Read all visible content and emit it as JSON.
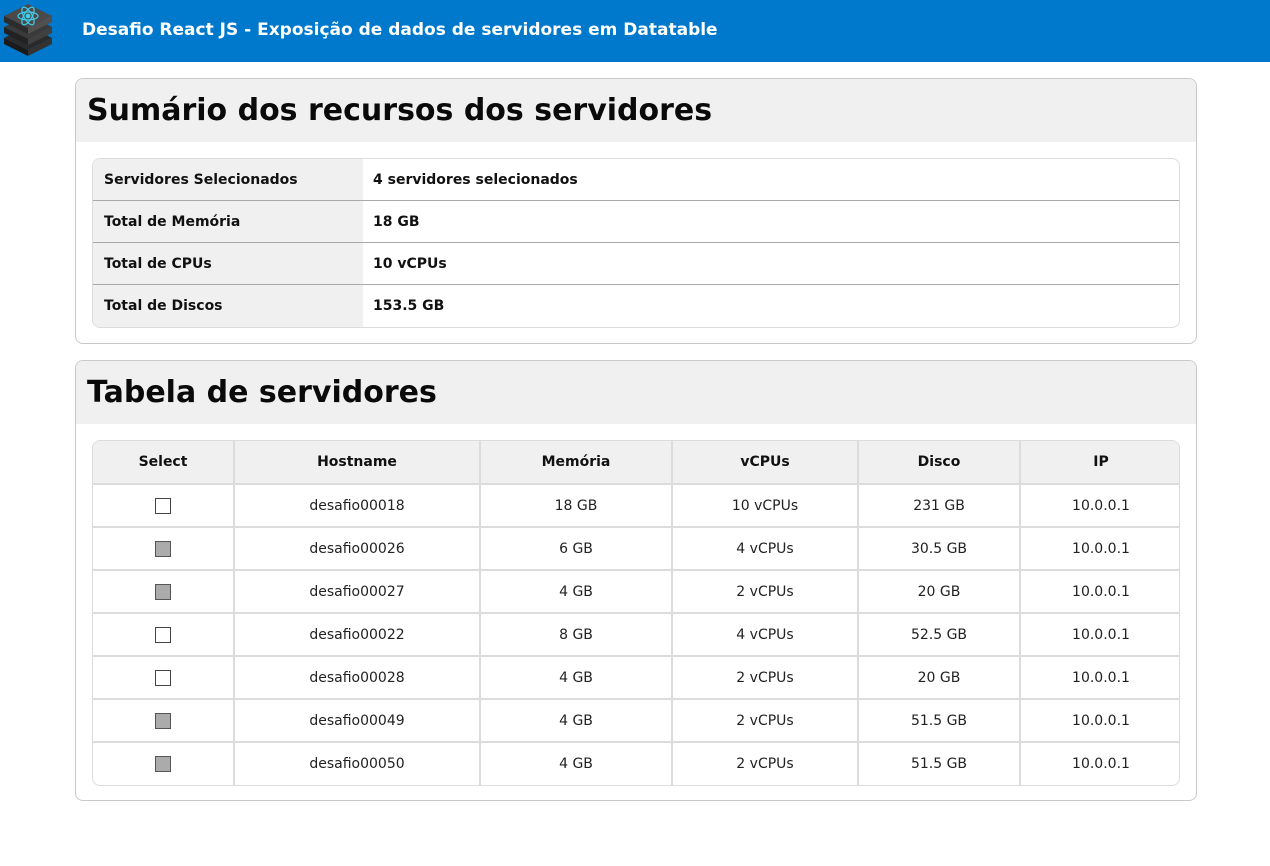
{
  "header": {
    "title": "Desafio React JS - Exposição de dados de servidores em Datatable",
    "logo_icon": "react-server-stack-icon"
  },
  "summary": {
    "title": "Sumário dos recursos dos servidores",
    "rows": [
      {
        "label": "Servidores Selecionados",
        "value": "4 servidores selecionados"
      },
      {
        "label": "Total de Memória",
        "value": "18 GB"
      },
      {
        "label": "Total de CPUs",
        "value": "10 vCPUs"
      },
      {
        "label": "Total de Discos",
        "value": "153.5 GB"
      }
    ]
  },
  "servers": {
    "title": "Tabela de servidores",
    "columns": [
      "Select",
      "Hostname",
      "Memória",
      "vCPUs",
      "Disco",
      "IP"
    ],
    "rows": [
      {
        "checked": false,
        "hostname": "desafio00018",
        "memory": "18 GB",
        "vcpus": "10 vCPUs",
        "disk": "231 GB",
        "ip": "10.0.0.1"
      },
      {
        "checked": true,
        "hostname": "desafio00026",
        "memory": "6 GB",
        "vcpus": "4 vCPUs",
        "disk": "30.5 GB",
        "ip": "10.0.0.1"
      },
      {
        "checked": true,
        "hostname": "desafio00027",
        "memory": "4 GB",
        "vcpus": "2 vCPUs",
        "disk": "20 GB",
        "ip": "10.0.0.1"
      },
      {
        "checked": false,
        "hostname": "desafio00022",
        "memory": "8 GB",
        "vcpus": "4 vCPUs",
        "disk": "52.5 GB",
        "ip": "10.0.0.1"
      },
      {
        "checked": false,
        "hostname": "desafio00028",
        "memory": "4 GB",
        "vcpus": "2 vCPUs",
        "disk": "20 GB",
        "ip": "10.0.0.1"
      },
      {
        "checked": true,
        "hostname": "desafio00049",
        "memory": "4 GB",
        "vcpus": "2 vCPUs",
        "disk": "51.5 GB",
        "ip": "10.0.0.1"
      },
      {
        "checked": true,
        "hostname": "desafio00050",
        "memory": "4 GB",
        "vcpus": "2 vCPUs",
        "disk": "51.5 GB",
        "ip": "10.0.0.1"
      }
    ]
  },
  "colors": {
    "header_bg": "#0079cc",
    "panel_header_bg": "#f0f0f0",
    "checked_fill": "#ababab"
  }
}
